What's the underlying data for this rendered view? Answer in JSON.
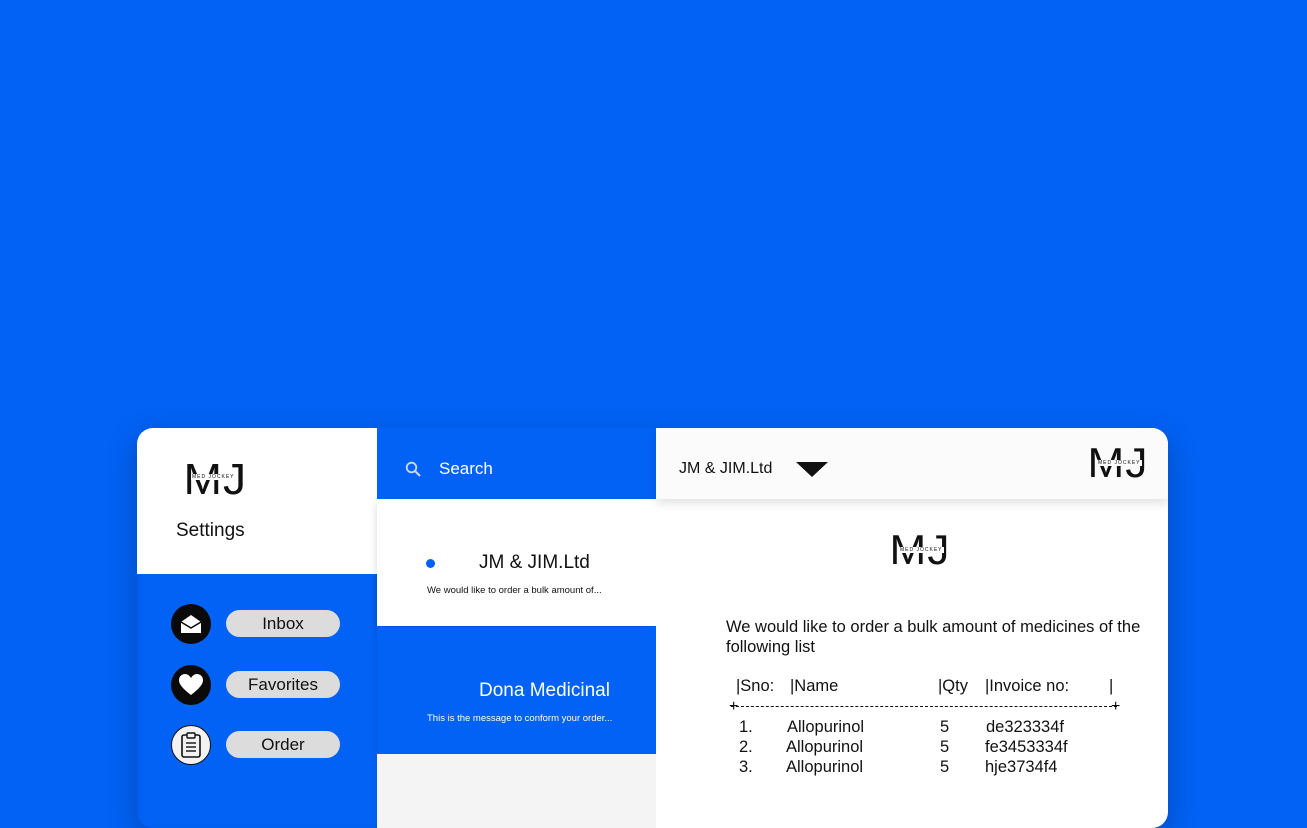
{
  "sidebar": {
    "logo_letters": "MJ",
    "logo_sub": "MED JOCKEY",
    "title": "Settings",
    "items": [
      {
        "label": "Inbox",
        "icon": "envelope-icon"
      },
      {
        "label": "Favorites",
        "icon": "heart-icon"
      },
      {
        "label": "Order",
        "icon": "clipboard-icon"
      }
    ]
  },
  "search": {
    "placeholder": "Search",
    "icon": "search-icon"
  },
  "messages": [
    {
      "name": "JM & JIM.Ltd",
      "preview": "We would like to order a bulk amount of...",
      "unread": true
    },
    {
      "name": "Dona Medicinal",
      "preview": "This is the message to conform your order...",
      "unread": false
    }
  ],
  "detail": {
    "company": "JM & JIM.Ltd",
    "header_logo_letters": "MJ",
    "header_logo_sub": "MED JOCKEY",
    "body_logo_letters": "MJ",
    "body_logo_sub": "MED JOCKEY",
    "body": "We would like to order a bulk amount of medicines of the following list",
    "table": {
      "headers": [
        "|Sno:",
        "|Name",
        "|Qty",
        "|Invoice no:",
        "|"
      ],
      "rows": [
        [
          "1.",
          "Allopurinol",
          "5",
          "de323334f"
        ],
        [
          "2.",
          "Allopurinol",
          "5",
          "fe3453334f"
        ],
        [
          "3.",
          "Allopurinol",
          "5",
          "hje3734f4"
        ]
      ]
    }
  },
  "colors": {
    "accent": "#0262F5",
    "background": "#0262F5"
  }
}
